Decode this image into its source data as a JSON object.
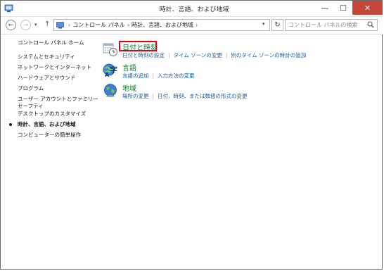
{
  "window": {
    "title": "時計、言語、および地域",
    "controls": {
      "minimize": "—",
      "maximize": "☐",
      "close": "✕"
    }
  },
  "nav": {
    "back": "←",
    "forward": "→",
    "menu": "▾",
    "up": "↑"
  },
  "address": {
    "crumbs": [
      "コントロール パネル",
      "時計、言語、および地域"
    ],
    "separator": "›",
    "dropdown": "▾",
    "refresh": "↻"
  },
  "search": {
    "placeholder": "コントロール パネルの検索"
  },
  "sidebar": {
    "items": [
      {
        "label": "コントロール パネル ホーム"
      },
      {
        "label": "システムとセキュリティ"
      },
      {
        "label": "ネットワークとインターネット"
      },
      {
        "label": "ハードウェアとサウンド"
      },
      {
        "label": "プログラム"
      },
      {
        "label": "ユーザー アカウントとファミリー セーフティ"
      },
      {
        "label": "デスクトップのカスタマイズ"
      },
      {
        "label": "時計、言語、および地域",
        "current": true
      },
      {
        "label": "コンピューターの簡単操作"
      }
    ]
  },
  "categories": [
    {
      "title": "日付と時刻",
      "icon": "calendar-clock-icon",
      "links": [
        "日付と時刻の設定",
        "タイム ゾーンの変更",
        "別のタイム ゾーンの時計の追加"
      ]
    },
    {
      "title": "言語",
      "icon": "language-icon",
      "links": [
        "言語の追加",
        "入力方法の変更"
      ]
    },
    {
      "title": "地域",
      "icon": "globe-icon",
      "links": [
        "場所の変更",
        "日付、時刻、または数値の形式の変更"
      ]
    }
  ],
  "colors": {
    "category_title": "#0a7a2a",
    "link": "#1a5fa8",
    "highlight": "#e3000f",
    "close_button": "#c7463a"
  }
}
